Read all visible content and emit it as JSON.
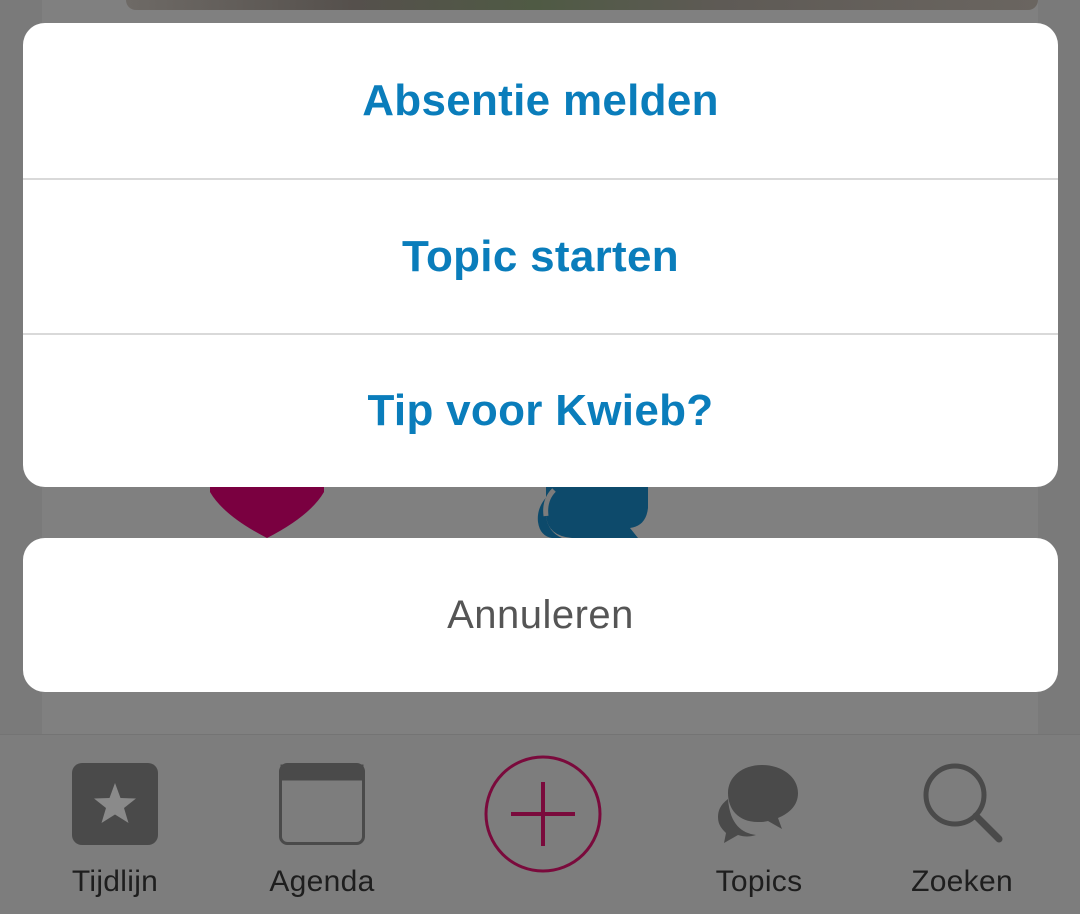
{
  "action_sheet": {
    "actions": [
      {
        "label": "Absentie melden"
      },
      {
        "label": "Topic starten"
      },
      {
        "label": "Tip voor Kwieb?"
      }
    ],
    "cancel_label": "Annuleren",
    "action_color": "#0a7dbb",
    "cancel_color": "#555555"
  },
  "tabbar": {
    "tabs": [
      {
        "label": "Tijdlijn",
        "icon": "star-icon"
      },
      {
        "label": "Agenda",
        "icon": "calendar-icon"
      },
      {
        "label": "Topics",
        "icon": "chat-bubbles-icon"
      },
      {
        "label": "Zoeken",
        "icon": "search-icon"
      }
    ],
    "add_icon": "plus-icon",
    "accent_color": "#7a0a3c"
  },
  "background": {
    "heart_color": "#7a0040",
    "bubble_color": "#0d4a6b"
  }
}
